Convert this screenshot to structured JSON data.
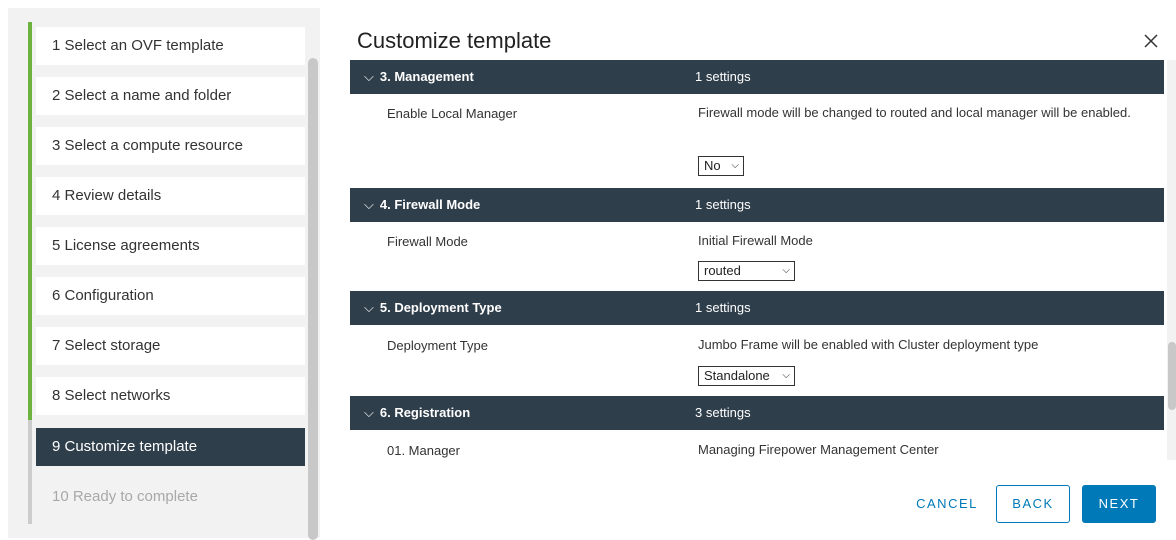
{
  "wizard": {
    "steps": [
      {
        "label": "1  Select an OVF template"
      },
      {
        "label": "2  Select a name and folder"
      },
      {
        "label": "3  Select a compute resource"
      },
      {
        "label": "4  Review details"
      },
      {
        "label": "5  License agreements"
      },
      {
        "label": "6  Configuration"
      },
      {
        "label": "7  Select storage"
      },
      {
        "label": "8  Select networks"
      },
      {
        "label": "9  Customize template"
      },
      {
        "label": "10  Ready to complete"
      }
    ]
  },
  "main": {
    "title": "Customize template",
    "sections": [
      {
        "name": "3. Management",
        "count": "1 settings",
        "label": "Enable Local Manager",
        "desc": "Firewall mode will be changed to routed and local manager will be enabled.",
        "select": "No"
      },
      {
        "name": "4. Firewall Mode",
        "count": "1 settings",
        "label": "Firewall Mode",
        "desc": "Initial Firewall Mode",
        "select": "routed"
      },
      {
        "name": "5. Deployment Type",
        "count": "1 settings",
        "label": "Deployment Type",
        "desc": "Jumbo Frame will be enabled with Cluster deployment type",
        "select": "Standalone"
      },
      {
        "name": "6. Registration",
        "count": "3 settings",
        "label": "01. Manager",
        "desc": "Managing Firepower Management Center"
      }
    ]
  },
  "footer": {
    "cancel": "CANCEL",
    "back": "BACK",
    "next": "NEXT"
  },
  "colors": {
    "accent": "#0079b8",
    "header_bg": "#2f3e4b",
    "progress": "#6db33f"
  }
}
